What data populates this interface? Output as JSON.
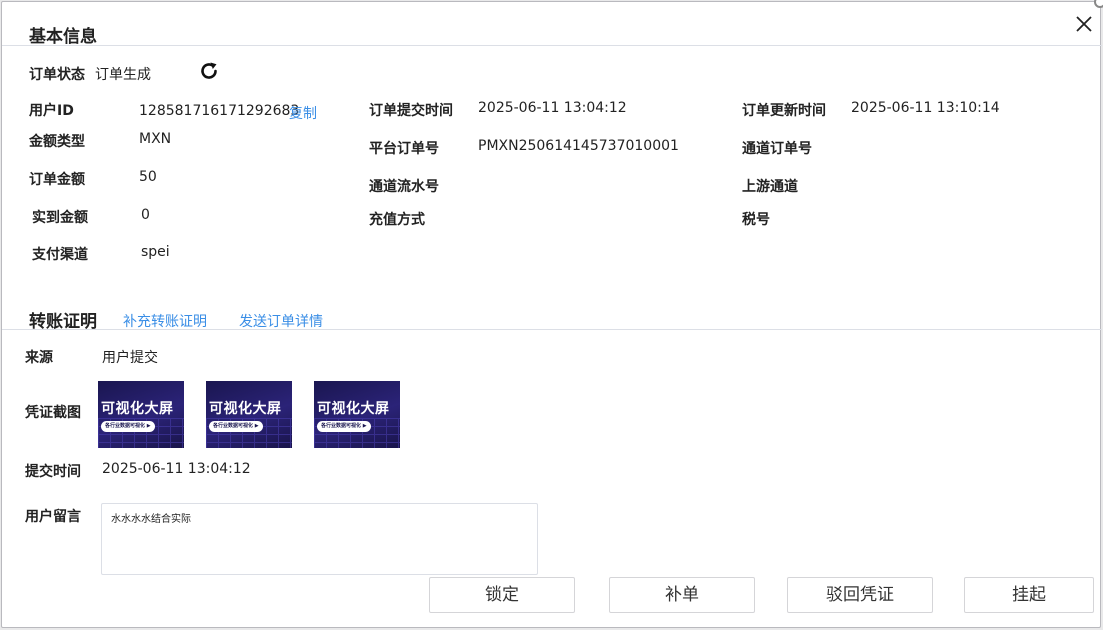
{
  "basic": {
    "title": "基本信息",
    "status_label": "订单状态",
    "status_value": "订单生成",
    "fields": {
      "user_id_label": "用户ID",
      "user_id_value": "128581716171292683",
      "copy_label": "复制",
      "currency_label": "金额类型",
      "currency_value": "MXN",
      "amount_label": "订单金额",
      "amount_value": "50",
      "received_label": "实到金额",
      "received_value": "0",
      "channel_label": "支付渠道",
      "channel_value": "spei",
      "submit_time_label": "订单提交时间",
      "submit_time_value": "2025-06-11 13:04:12",
      "platform_order_label": "平台订单号",
      "platform_order_value": "PMXN250614145737010001",
      "channel_serial_label": "通道流水号",
      "recharge_method_label": "充值方式",
      "update_time_label": "订单更新时间",
      "update_time_value": "2025-06-11 13:10:14",
      "channel_order_label": "通道订单号",
      "upstream_label": "上游通道",
      "tax_label": "税号"
    }
  },
  "proof": {
    "title": "转账证明",
    "add_proof_link": "补充转账证明",
    "send_details_link": "发送订单详情",
    "source_label": "来源",
    "source_value": "用户提交",
    "screenshot_label": "凭证截图",
    "thumbnails": [
      {
        "title": "可视化大屏",
        "subtitle": "各行业数据可视化 ▶"
      },
      {
        "title": "可视化大屏",
        "subtitle": "各行业数据可视化 ▶"
      },
      {
        "title": "可视化大屏",
        "subtitle": "各行业数据可视化 ▶"
      }
    ],
    "submit_time_label": "提交时间",
    "submit_time_value": "2025-06-11 13:04:12",
    "message_label": "用户留言",
    "message_value": "水水水水结合实际"
  },
  "actions": {
    "lock": "锁定",
    "supplement": "补单",
    "reject_proof": "驳回凭证",
    "suspend": "挂起"
  },
  "colors": {
    "link": "#3a8ee6",
    "border": "#dcdfe6"
  }
}
